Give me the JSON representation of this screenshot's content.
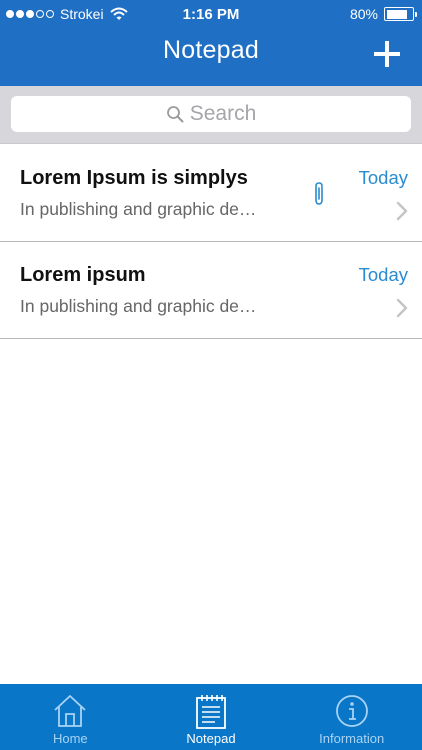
{
  "status_bar": {
    "carrier": "Strokei",
    "time": "1:16 PM",
    "battery": "80%",
    "battery_level": 0.8
  },
  "nav": {
    "title": "Notepad",
    "add_icon": "plus-icon"
  },
  "search": {
    "placeholder": "Search"
  },
  "notes": [
    {
      "title": "Lorem Ipsum is simplys",
      "preview": "In publishing and graphic de…",
      "date": "Today",
      "has_attachment": true
    },
    {
      "title": "Lorem ipsum",
      "preview": "In publishing and graphic de…",
      "date": "Today",
      "has_attachment": false
    }
  ],
  "tabs": [
    {
      "label": "Home",
      "icon": "home-icon",
      "active": false
    },
    {
      "label": "Notepad",
      "icon": "notepad-icon",
      "active": true
    },
    {
      "label": "Information",
      "icon": "info-icon",
      "active": false
    }
  ],
  "colors": {
    "header": "#1f6fc4",
    "tab_bar": "#0a76c8",
    "accent": "#2a8bd0"
  }
}
